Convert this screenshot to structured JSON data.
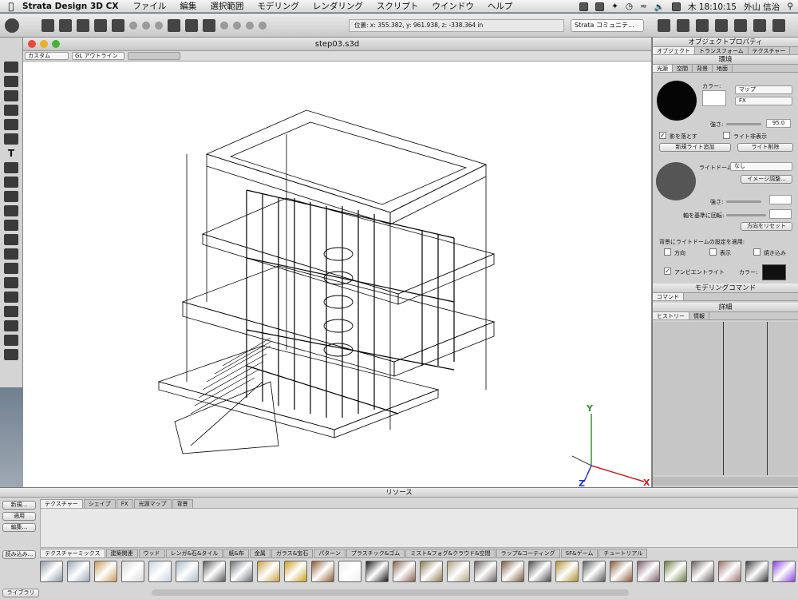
{
  "menubar": {
    "app_name": "Strata Design 3D CX",
    "items": [
      "ファイル",
      "編集",
      "選択範囲",
      "モデリング",
      "レンダリング",
      "スクリプト",
      "ウインドウ",
      "ヘルプ"
    ],
    "clock": "木 18:10:15",
    "user": "外山 信治"
  },
  "toolbar": {
    "coords": "位置: x: 355.382, y: 961.938, z: -338.364 in",
    "community": "Strata コミュニテ..."
  },
  "document": {
    "title": "step03.s3d",
    "view_mode": "カスタム",
    "render_mode": "GL アウトライン"
  },
  "axes": {
    "x": "X",
    "y": "Y",
    "z": "Z"
  },
  "object_properties": {
    "title": "オブジェクトプロパティ",
    "tabs": [
      "オブジェクト",
      "トランスフォーム",
      "テクスチャー"
    ],
    "section": "環境",
    "subtabs": [
      "光源",
      "空間",
      "背景",
      "地面"
    ],
    "color_label": "カラー:",
    "map_select": "マップ",
    "fx_select": "FX",
    "strength_label": "強さ:",
    "strength_value": "95.0",
    "cast_shadow": "影を落とす",
    "hide_light": "ライト非表示",
    "add_light": "新規ライト追加",
    "delete_light": "ライト削除",
    "light_dome_label": "ライトドーム:",
    "light_dome_value": "なし",
    "image_adjust": "イメージ調整...",
    "strength2_label": "強さ:",
    "rotate_label": "軸を基準に回転:",
    "reset_direction": "方向をリセット",
    "apply_label": "背景にライトドームの設定を適用:",
    "opt_direction": "方向",
    "opt_display": "表示",
    "opt_crop": "焼き込み",
    "ambient": "アンビエントライト",
    "ambient_color_label": "カラー:"
  },
  "modeling": {
    "title": "モデリングコマンド",
    "tab": "コマンド"
  },
  "detail": {
    "title": "詳細",
    "tabs": [
      "ヒストリー",
      "情報"
    ]
  },
  "resources": {
    "title": "リソース",
    "buttons": [
      "新規...",
      "適用",
      "編集...",
      "読み込み..."
    ],
    "tabs": [
      "テクスチャー",
      "シェイプ",
      "FX",
      "光源マップ",
      "背景"
    ],
    "categories": [
      "テクスチャーミックス",
      "建築関連",
      "ウッド",
      "レンガ&石&タイル",
      "紙&布",
      "金属",
      "ガラス&宝石",
      "パターン",
      "プラスチック&ゴム",
      "ミスト&フォグ&クラウド&空間",
      "ラップ&コーティング",
      "SF&ゲーム",
      "チュートリアル"
    ],
    "library": "ライブラリ"
  },
  "swatch_colors": [
    "#8a9aa8",
    "#9aa8b8",
    "#c89a5a",
    "#d8d8d8",
    "#c8d4e0",
    "#a8b8c8",
    "#5a5a5a",
    "#6a6e74",
    "#c8a040",
    "#c8a020",
    "#8a5a30",
    "#f0f0f0",
    "#1a1a1a",
    "#8a6050",
    "#8a7a50",
    "#b0a080",
    "#6a6060",
    "#7a5a40",
    "#4a4a4a",
    "#b09030",
    "#5a5a5a",
    "#8a5a3a",
    "#7a5a6a",
    "#6a7a40",
    "#6a6060",
    "#9a7070",
    "#3a3a3a",
    "#8a40e0"
  ]
}
